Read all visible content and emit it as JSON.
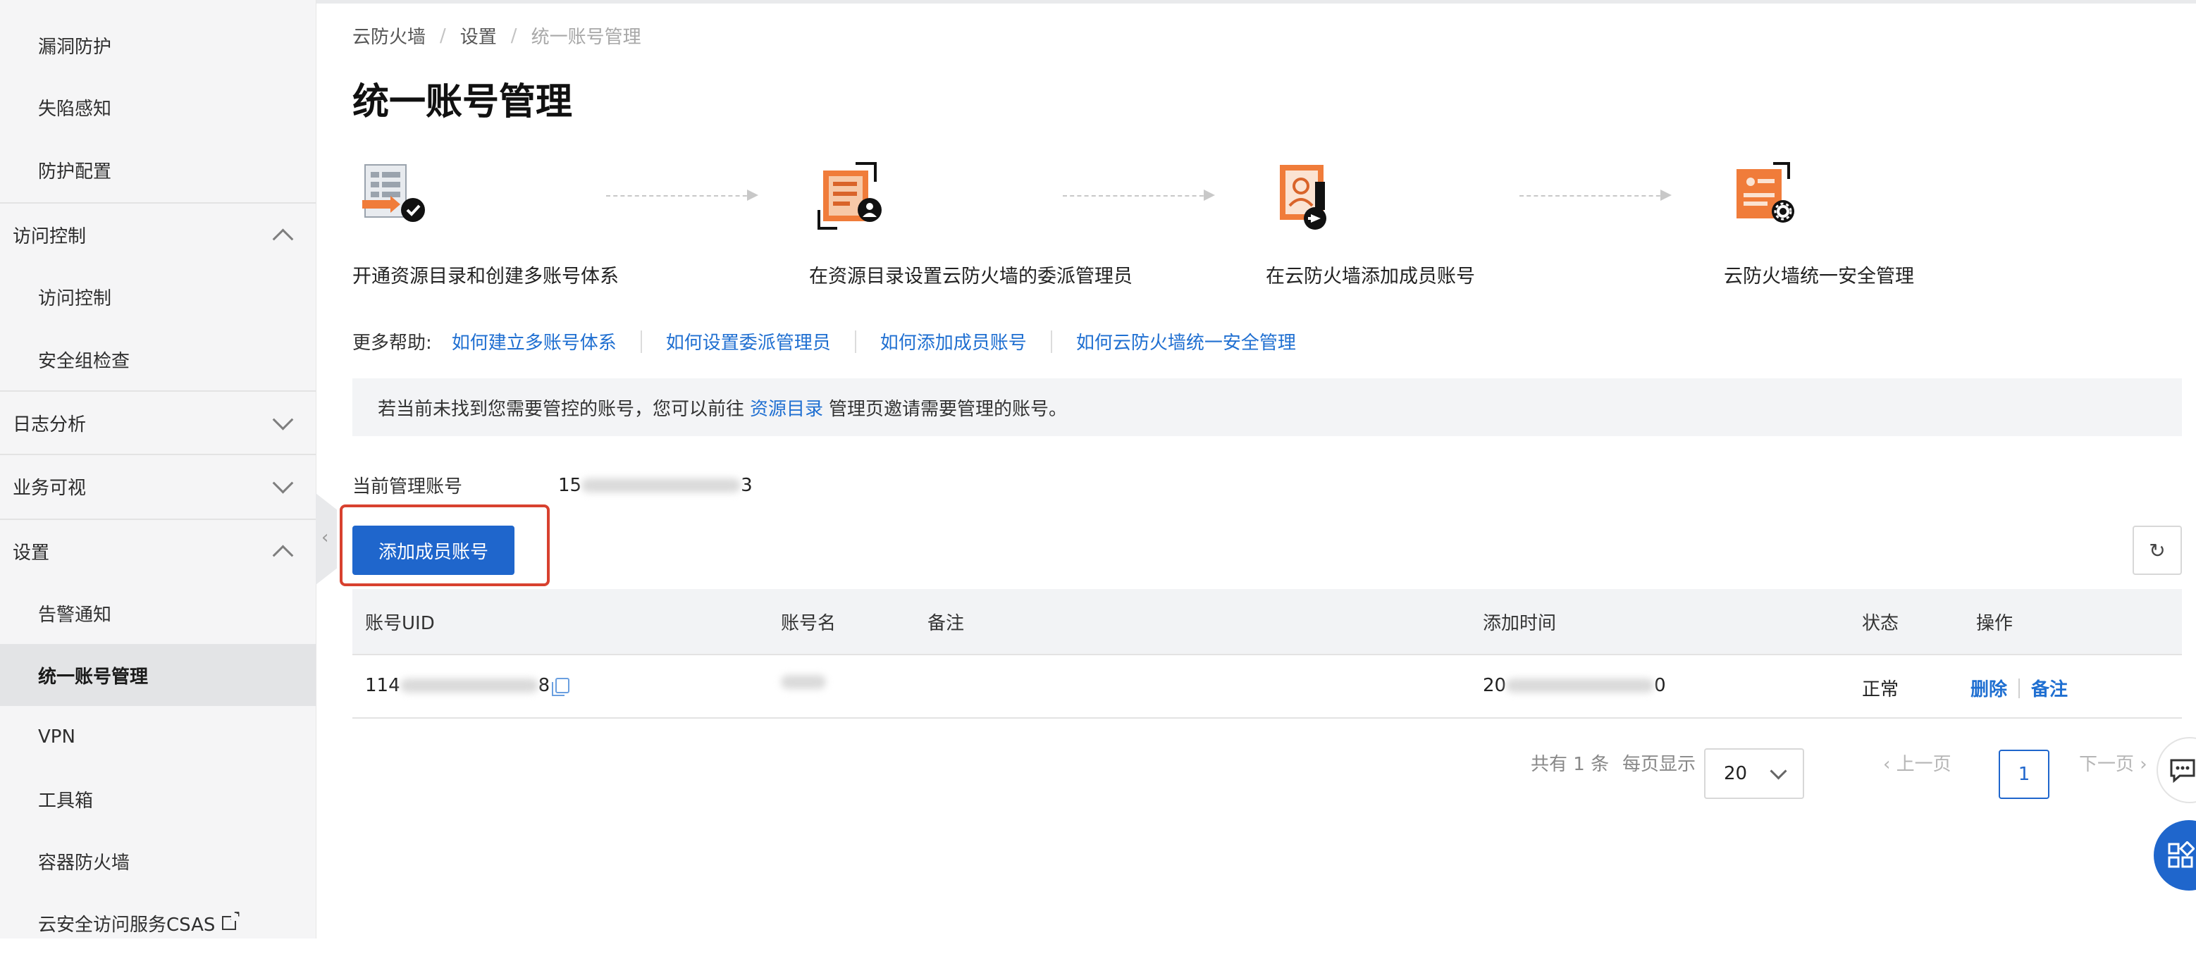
{
  "sidebar": {
    "items": [
      {
        "label": "漏洞防护"
      },
      {
        "label": "失陷感知"
      },
      {
        "label": "防护配置"
      },
      {
        "label": "访问控制"
      },
      {
        "label": "访问控制"
      },
      {
        "label": "安全组检查"
      },
      {
        "label": "日志分析"
      },
      {
        "label": "业务可视"
      },
      {
        "label": "设置"
      },
      {
        "label": "告警通知"
      },
      {
        "label": "统一账号管理"
      },
      {
        "label": "VPN"
      },
      {
        "label": "工具箱"
      },
      {
        "label": "容器防火墙"
      },
      {
        "label": "云安全访问服务CSAS"
      }
    ]
  },
  "breadcrumb": [
    "云防火墙",
    "设置",
    "统一账号管理"
  ],
  "breadcrumb_sep": "/",
  "page_title": "统一账号管理",
  "steps": [
    {
      "label": "开通资源目录和创建多账号体系",
      "icon": "resource-directory-icon"
    },
    {
      "label": "在资源目录设置云防火墙的委派管理员",
      "icon": "delegated-admin-icon"
    },
    {
      "label": "在云防火墙添加成员账号",
      "icon": "add-member-icon"
    },
    {
      "label": "云防火墙统一安全管理",
      "icon": "unified-management-icon"
    }
  ],
  "help": {
    "label": "更多帮助:",
    "links": [
      "如何建立多账号体系",
      "如何设置委派管理员",
      "如何添加成员账号",
      "如何云防火墙统一安全管理"
    ]
  },
  "notice": {
    "prefix": "若当前未找到您需要管控的账号，您可以前往",
    "link": "资源目录",
    "suffix": "管理页邀请需要管理的账号。"
  },
  "current_account": {
    "label": "当前管理账号",
    "value_prefix": "15",
    "value_suffix": "3"
  },
  "add_button": "添加成员账号",
  "table": {
    "headers": [
      "账号UID",
      "账号名",
      "备注",
      "添加时间",
      "状态",
      "操作"
    ],
    "rows": [
      {
        "uid_prefix": "114",
        "uid_suffix": "8",
        "name": "",
        "remark": "",
        "time_prefix": "20",
        "time_suffix": "0",
        "status": "正常",
        "actions": [
          "删除",
          "备注"
        ]
      }
    ]
  },
  "pagination": {
    "total": "共有 1 条",
    "per_page_label": "每页显示",
    "page_size": "20",
    "prev": "上一页",
    "current": "1",
    "next": "下一页"
  },
  "colors": {
    "primary": "#1f66cc",
    "link": "#1f6fd1",
    "highlight_border": "#d8412f",
    "icon_orange": "#f07c3a"
  }
}
